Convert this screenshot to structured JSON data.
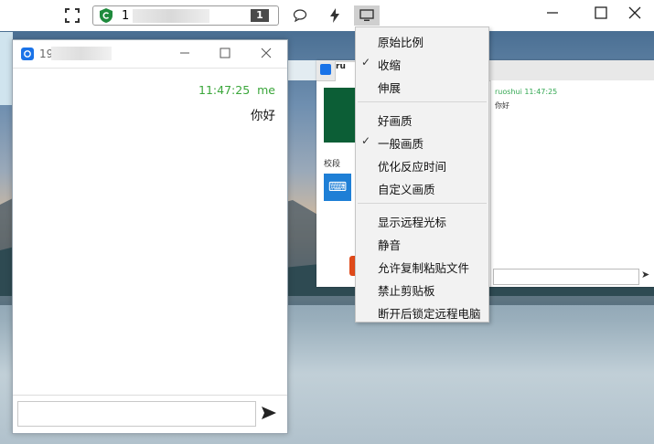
{
  "toolbar": {
    "fullscreen_icon": "fullscreen-icon",
    "shield_icon": "shield-check-icon",
    "id_prefix": "1",
    "id_badge": "1",
    "chat_icon": "chat-bubble-icon",
    "action_icon": "lightning-icon",
    "display_icon": "monitor-icon",
    "minimize_icon": "minimize-icon",
    "maximize_icon": "maximize-icon",
    "close_icon": "close-icon"
  },
  "menu": {
    "groups": [
      [
        {
          "label": "原始比例",
          "checked": false
        },
        {
          "label": "收缩",
          "checked": true
        },
        {
          "label": "伸展",
          "checked": false
        }
      ],
      [
        {
          "label": "好画质",
          "checked": false
        },
        {
          "label": "一般画质",
          "checked": true
        },
        {
          "label": "优化反应时间",
          "checked": false
        },
        {
          "label": "自定义画质",
          "checked": false
        }
      ],
      [
        {
          "label": "显示远程光标",
          "checked": false
        },
        {
          "label": "静音",
          "checked": false
        },
        {
          "label": "允许复制粘贴文件",
          "checked": false
        },
        {
          "label": "禁止剪贴板",
          "checked": false
        },
        {
          "label": "断开后锁定远程电脑",
          "checked": false
        }
      ]
    ]
  },
  "chat": {
    "id_prefix": "19",
    "messages": [
      {
        "time": "11:47:25",
        "sender": "me",
        "text": "你好"
      }
    ],
    "input_placeholder": "",
    "send_icon": "send-arrow-icon"
  },
  "remote": {
    "tab_label": "ru",
    "section_label": "校段",
    "chat_sender": "ruoshui",
    "chat_time": "11:47:25",
    "chat_text": "你好",
    "send_icon": "send-arrow-icon"
  },
  "colors": {
    "accent_green": "#3aa63a",
    "brand_blue": "#1a73e8",
    "menu_bg": "#f2f2f2"
  }
}
